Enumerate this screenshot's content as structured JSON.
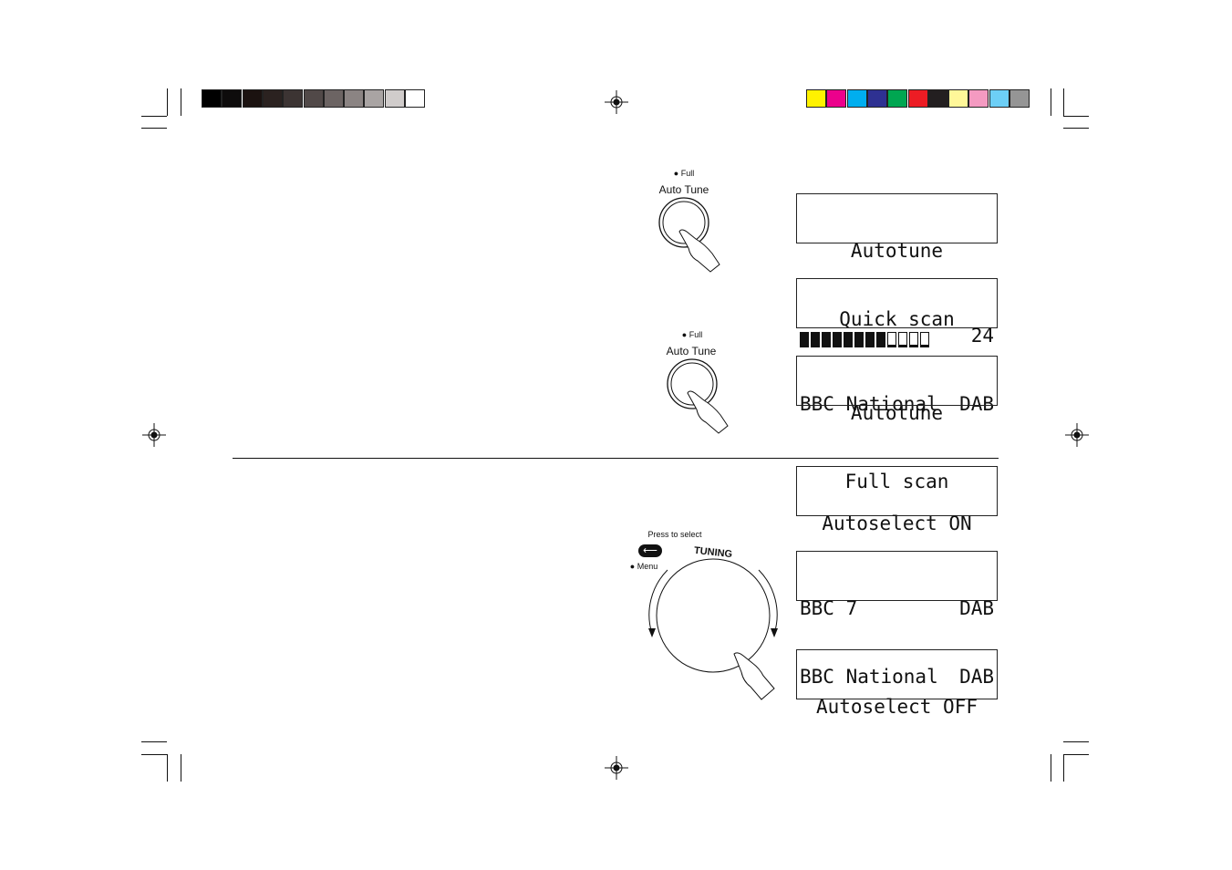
{
  "colors": {
    "grayscale": [
      "#000000",
      "#0e0c0c",
      "#1b1210",
      "#2b2220",
      "#3c3433",
      "#514948",
      "#6c6463",
      "#8b8483",
      "#a9a4a3",
      "#d0cccb",
      "#ffffff"
    ],
    "process": [
      "#fff200",
      "#ec008c",
      "#00aeef",
      "#2e3192",
      "#00a651",
      "#ed1c24",
      "#231f20",
      "#fff799",
      "#f49ac1",
      "#6dcff6",
      "#959595"
    ]
  },
  "autotune_button_1": {
    "hold_label": "Full",
    "label": "Auto Tune",
    "icon": "finger-press-icon"
  },
  "autotune_button_2": {
    "hold_label": "Full",
    "label": "Auto Tune",
    "icon": "finger-press-icon"
  },
  "tuning_control": {
    "press_label": "Press to select",
    "menu_label": "Menu",
    "dial_label": "TUNING",
    "icon": "enter-icon"
  },
  "displays": {
    "quick_scan": {
      "line1": "Autotune",
      "line2": "Quick scan"
    },
    "progress": {
      "progress_filled": 8,
      "progress_total": 12,
      "count": "24",
      "station": "BBC National",
      "band": "DAB"
    },
    "full_scan": {
      "line1": "Autotune",
      "line2": "Full scan"
    },
    "autoselect_on": {
      "line1": "Autoselect ON"
    },
    "stations": {
      "row1_station": "BBC 7",
      "row1_band": "DAB",
      "row2_station": "BBC National",
      "row2_band": "DAB"
    },
    "autoselect_off": {
      "line1": "Autoselect OFF"
    }
  }
}
